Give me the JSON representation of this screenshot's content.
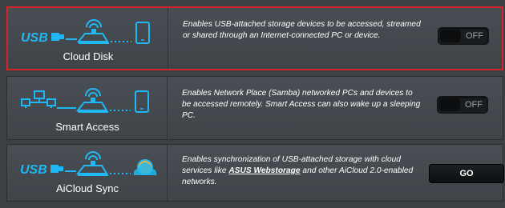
{
  "colors": {
    "background": "#3c4146",
    "card": "#484e53",
    "icon_blue": "#1fb8f5",
    "highlight_border": "#d6242a",
    "toggle_bg": "#1a1d1f"
  },
  "features": [
    {
      "title": "Cloud Disk",
      "description": "Enables USB-attached storage devices to be accessed, streamed or shared through an Internet-connected PC or device.",
      "icons": [
        "usb-icon",
        "router-icon",
        "tablet-icon"
      ],
      "control": {
        "type": "toggle",
        "label": "OFF",
        "state": "off"
      },
      "selected": true
    },
    {
      "title": "Smart Access",
      "description": "Enables Network Place (Samba) networked PCs and devices to be accessed remotely. Smart Access can also wake up a sleeping PC.",
      "icons": [
        "network-icon",
        "router-icon",
        "tablet-icon"
      ],
      "control": {
        "type": "toggle",
        "label": "OFF",
        "state": "off"
      },
      "selected": false
    },
    {
      "title": "AiCloud Sync",
      "description_before": "Enables synchronization of USB-attached storage with cloud services like ",
      "description_link": "ASUS Webstorage",
      "description_after": " and other AiCloud 2.0-enabled networks.",
      "icons": [
        "usb-icon",
        "router-icon",
        "cloud-icon"
      ],
      "control": {
        "type": "button",
        "label": "GO"
      },
      "selected": false
    }
  ]
}
